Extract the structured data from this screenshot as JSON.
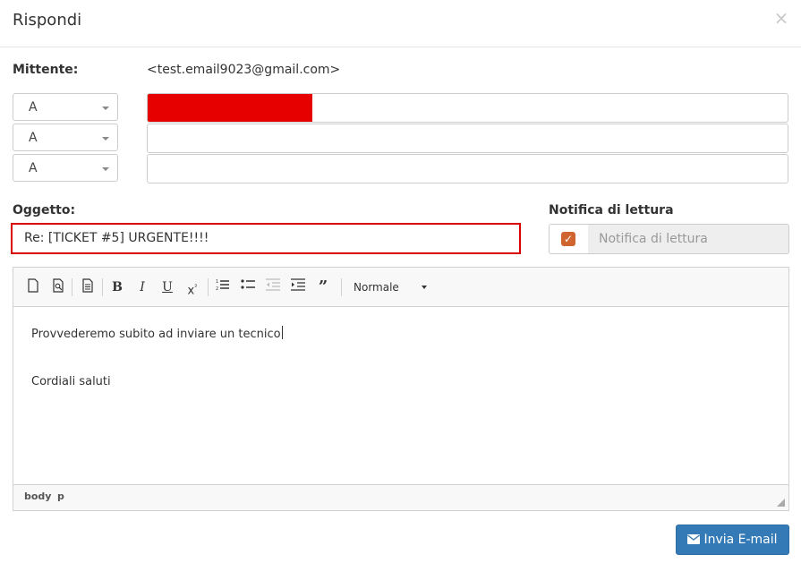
{
  "dialog": {
    "title": "Rispondi",
    "close_symbol": "×"
  },
  "sender": {
    "label": "Mittente:",
    "value": "<test.email9023@gmail.com>"
  },
  "recipients": [
    {
      "type": "A",
      "value": "",
      "redacted": true
    },
    {
      "type": "A",
      "value": "",
      "redacted": false
    },
    {
      "type": "A",
      "value": "",
      "redacted": false
    }
  ],
  "subject": {
    "label": "Oggetto:",
    "value": "Re: [TICKET #5] URGENTE!!!!"
  },
  "read_receipt": {
    "label": "Notifica di lettura",
    "checked": true,
    "placeholder": "Notifica di lettura",
    "check_color": "#d0652f"
  },
  "editor": {
    "toolbar": {
      "icons": [
        "new-document-icon",
        "preview-icon",
        "template-icon",
        "bold-icon",
        "italic-icon",
        "underline-icon",
        "superscript-icon",
        "numbered-list-icon",
        "bulleted-list-icon",
        "decrease-indent-icon",
        "increase-indent-icon",
        "blockquote-icon"
      ],
      "format": "Normale"
    },
    "body_lines": [
      "Provvederemo subito ad inviare un tecnico",
      "Cordiali saluti"
    ],
    "status_path": [
      "body",
      "p"
    ]
  },
  "send_button": {
    "label": "Invia E-mail",
    "color": "#337ab7"
  }
}
